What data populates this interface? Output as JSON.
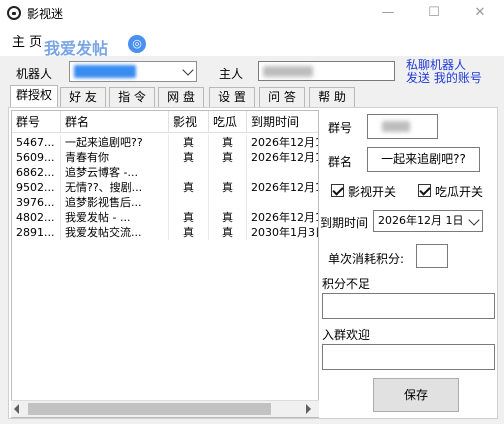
{
  "window": {
    "title": "影视迷",
    "controls": {
      "minimize": "—",
      "maximize": "☐",
      "close": "✕"
    }
  },
  "menu": {
    "home": "主 页"
  },
  "watermark": {
    "text": "我爱发帖",
    "badge": "◎"
  },
  "top": {
    "robot_label": "机器人",
    "robot_value": "",
    "owner_label": "主人",
    "owner_value": "",
    "link_private_chat": "私聊机器人",
    "link_send_account": "发送 我的账号"
  },
  "tabs": [
    "群授权",
    "好 友",
    "指 令",
    "网 盘",
    "设 置",
    "问 答",
    "帮 助"
  ],
  "grid": {
    "columns": [
      "群号",
      "群名",
      "影视",
      "吃瓜",
      "到期时间"
    ],
    "rows": [
      [
        "5467...",
        "一起来追剧吧??",
        "真",
        "真",
        "2026年12月1"
      ],
      [
        "5609...",
        "青春有你",
        "真",
        "真",
        "2026年12月1"
      ],
      [
        "6862...",
        "追梦云博客 -...",
        "",
        "",
        ""
      ],
      [
        "9502...",
        "无情??、搜剧...",
        "真",
        "真",
        "2026年12月1"
      ],
      [
        "3976...",
        "追梦影视售后...",
        "",
        "",
        ""
      ],
      [
        "4802...",
        "我爱发帖 - ...",
        "真",
        "真",
        "2026年12月1"
      ],
      [
        "2891...",
        "我爱发帖交流...",
        "真",
        "真",
        "2030年1月3日"
      ]
    ]
  },
  "detail": {
    "group_id_label": "群号",
    "group_id_value": "",
    "group_name_label": "群名",
    "group_name_value": "一起来追剧吧??",
    "movie_switch_label": "影视开关",
    "melon_switch_label": "吃瓜开关",
    "movie_switch_checked": true,
    "melon_switch_checked": true,
    "expire_label": "到期时间",
    "expire_value": "2026年12月 1日",
    "points_label": "单次消耗积分:",
    "points_value": "",
    "insufficient_label": "积分不足",
    "insufficient_value": "",
    "welcome_label": "入群欢迎",
    "welcome_value": "",
    "save_label": "保存"
  }
}
